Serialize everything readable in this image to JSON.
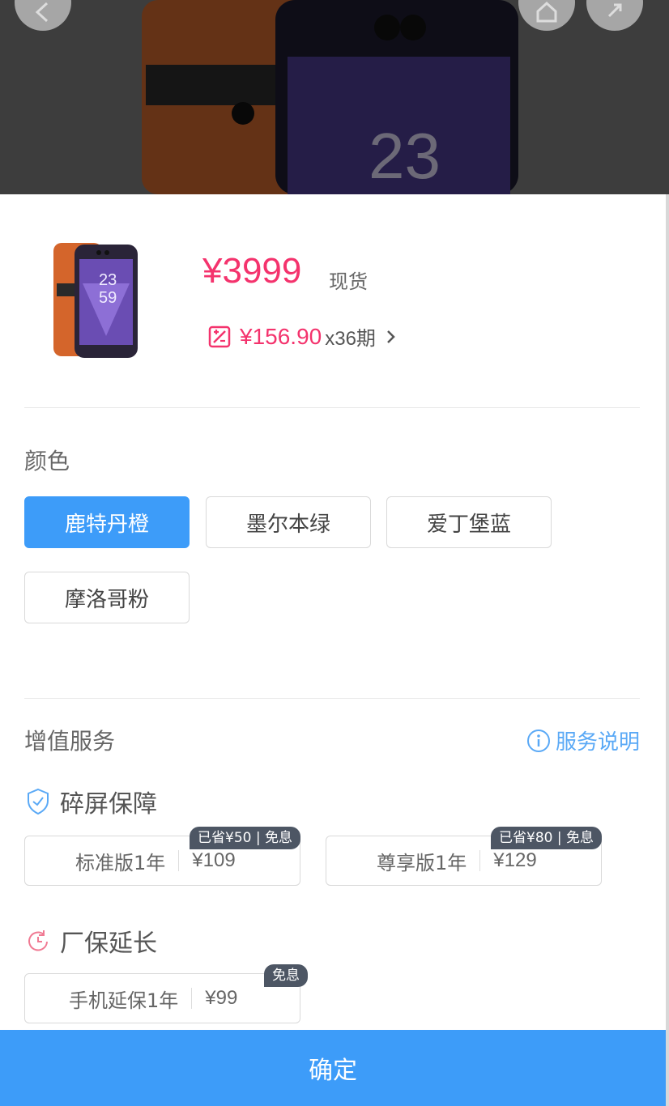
{
  "product": {
    "price": "¥3999",
    "stock": "现货",
    "installment_amount": "¥156.90",
    "installment_period": "x36期"
  },
  "color_section": {
    "title": "颜色",
    "options": [
      "鹿特丹橙",
      "墨尔本绿",
      "爱丁堡蓝",
      "摩洛哥粉"
    ],
    "selected": "鹿特丹橙"
  },
  "value_services": {
    "title": "增值服务",
    "info_link": "服务说明",
    "screen_protection": {
      "title": "碎屏保障",
      "options": [
        {
          "name": "标准版1年",
          "price": "¥109",
          "tag": "已省¥50 | 免息"
        },
        {
          "name": "尊享版1年",
          "price": "¥129",
          "tag": "已省¥80 | 免息"
        }
      ]
    },
    "warranty_extension": {
      "title": "厂保延长",
      "options": [
        {
          "name": "手机延保1年",
          "price": "¥99",
          "tag": "免息"
        }
      ]
    }
  },
  "confirm_label": "确定",
  "colors": {
    "accent": "#3d9cf9",
    "price": "#f4336d",
    "tag_bg": "#4d5664"
  }
}
